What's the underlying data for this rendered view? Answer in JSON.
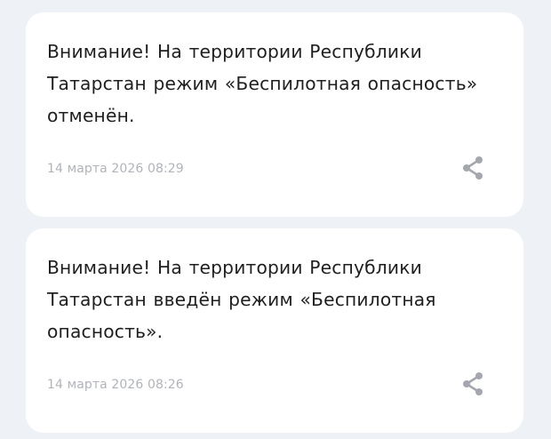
{
  "posts": [
    {
      "text": "Внимание! На территории Республики Татарстан режим «Беспилотная опасность» отменён.",
      "timestamp": "14 марта 2026 08:29",
      "share_icon": "share-icon"
    },
    {
      "text": "Внимание! На территории Республики Татарстан введён режим «Беспилотная опасность».",
      "timestamp": "14 марта 2026 08:26",
      "share_icon": "share-icon"
    }
  ],
  "colors": {
    "background": "#eef1f5",
    "card": "#ffffff",
    "text": "#1f1f1f",
    "timestamp": "#b0b4ba",
    "icon": "#a4a8ae"
  }
}
